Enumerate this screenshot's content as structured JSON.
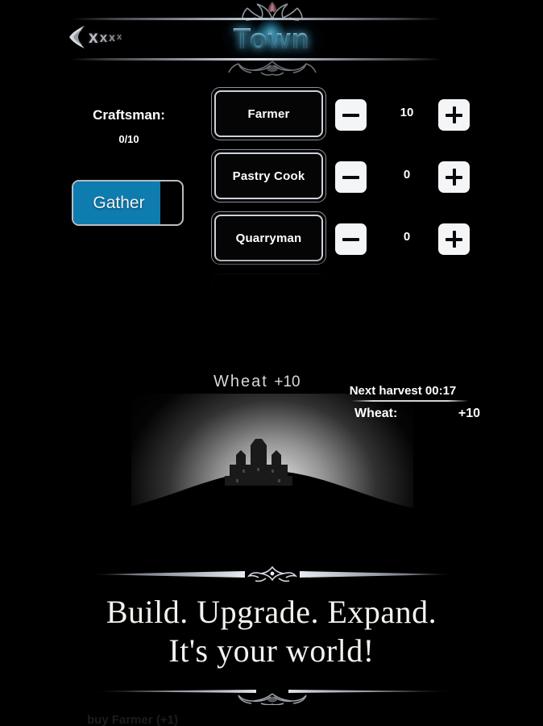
{
  "header": {
    "title": "Town",
    "back_icon": "back-arrow-icon",
    "x_marks": [
      "x",
      "x",
      "x",
      "x"
    ]
  },
  "craftsman": {
    "label": "Craftsman:",
    "count": "0/10",
    "gather_label": "Gather",
    "gather_progress_percent": 80,
    "gather_color": "#0f7cb0"
  },
  "jobs": {
    "rows": [
      {
        "name": "Farmer",
        "count": "10",
        "minus_icon": "minus-icon",
        "plus_icon": "plus-icon"
      },
      {
        "name": "Pastry Cook",
        "count": "0",
        "minus_icon": "minus-icon",
        "plus_icon": "plus-icon"
      },
      {
        "name": "Quarryman",
        "count": "0",
        "minus_icon": "minus-icon",
        "plus_icon": "plus-icon"
      }
    ]
  },
  "scene": {
    "float_gain_resource": "Wheat",
    "float_gain_amount": "+10",
    "castle_icon": "castle-silhouette-icon"
  },
  "harvest": {
    "title": "Next harvest 00:17",
    "resource_label": "Wheat:",
    "resource_amount": "+10"
  },
  "tagline": {
    "line1": "Build. Upgrade. Expand.",
    "line2": "It's your world!"
  },
  "bottom": {
    "cut_off_text": "buy Farmer (+1)"
  }
}
